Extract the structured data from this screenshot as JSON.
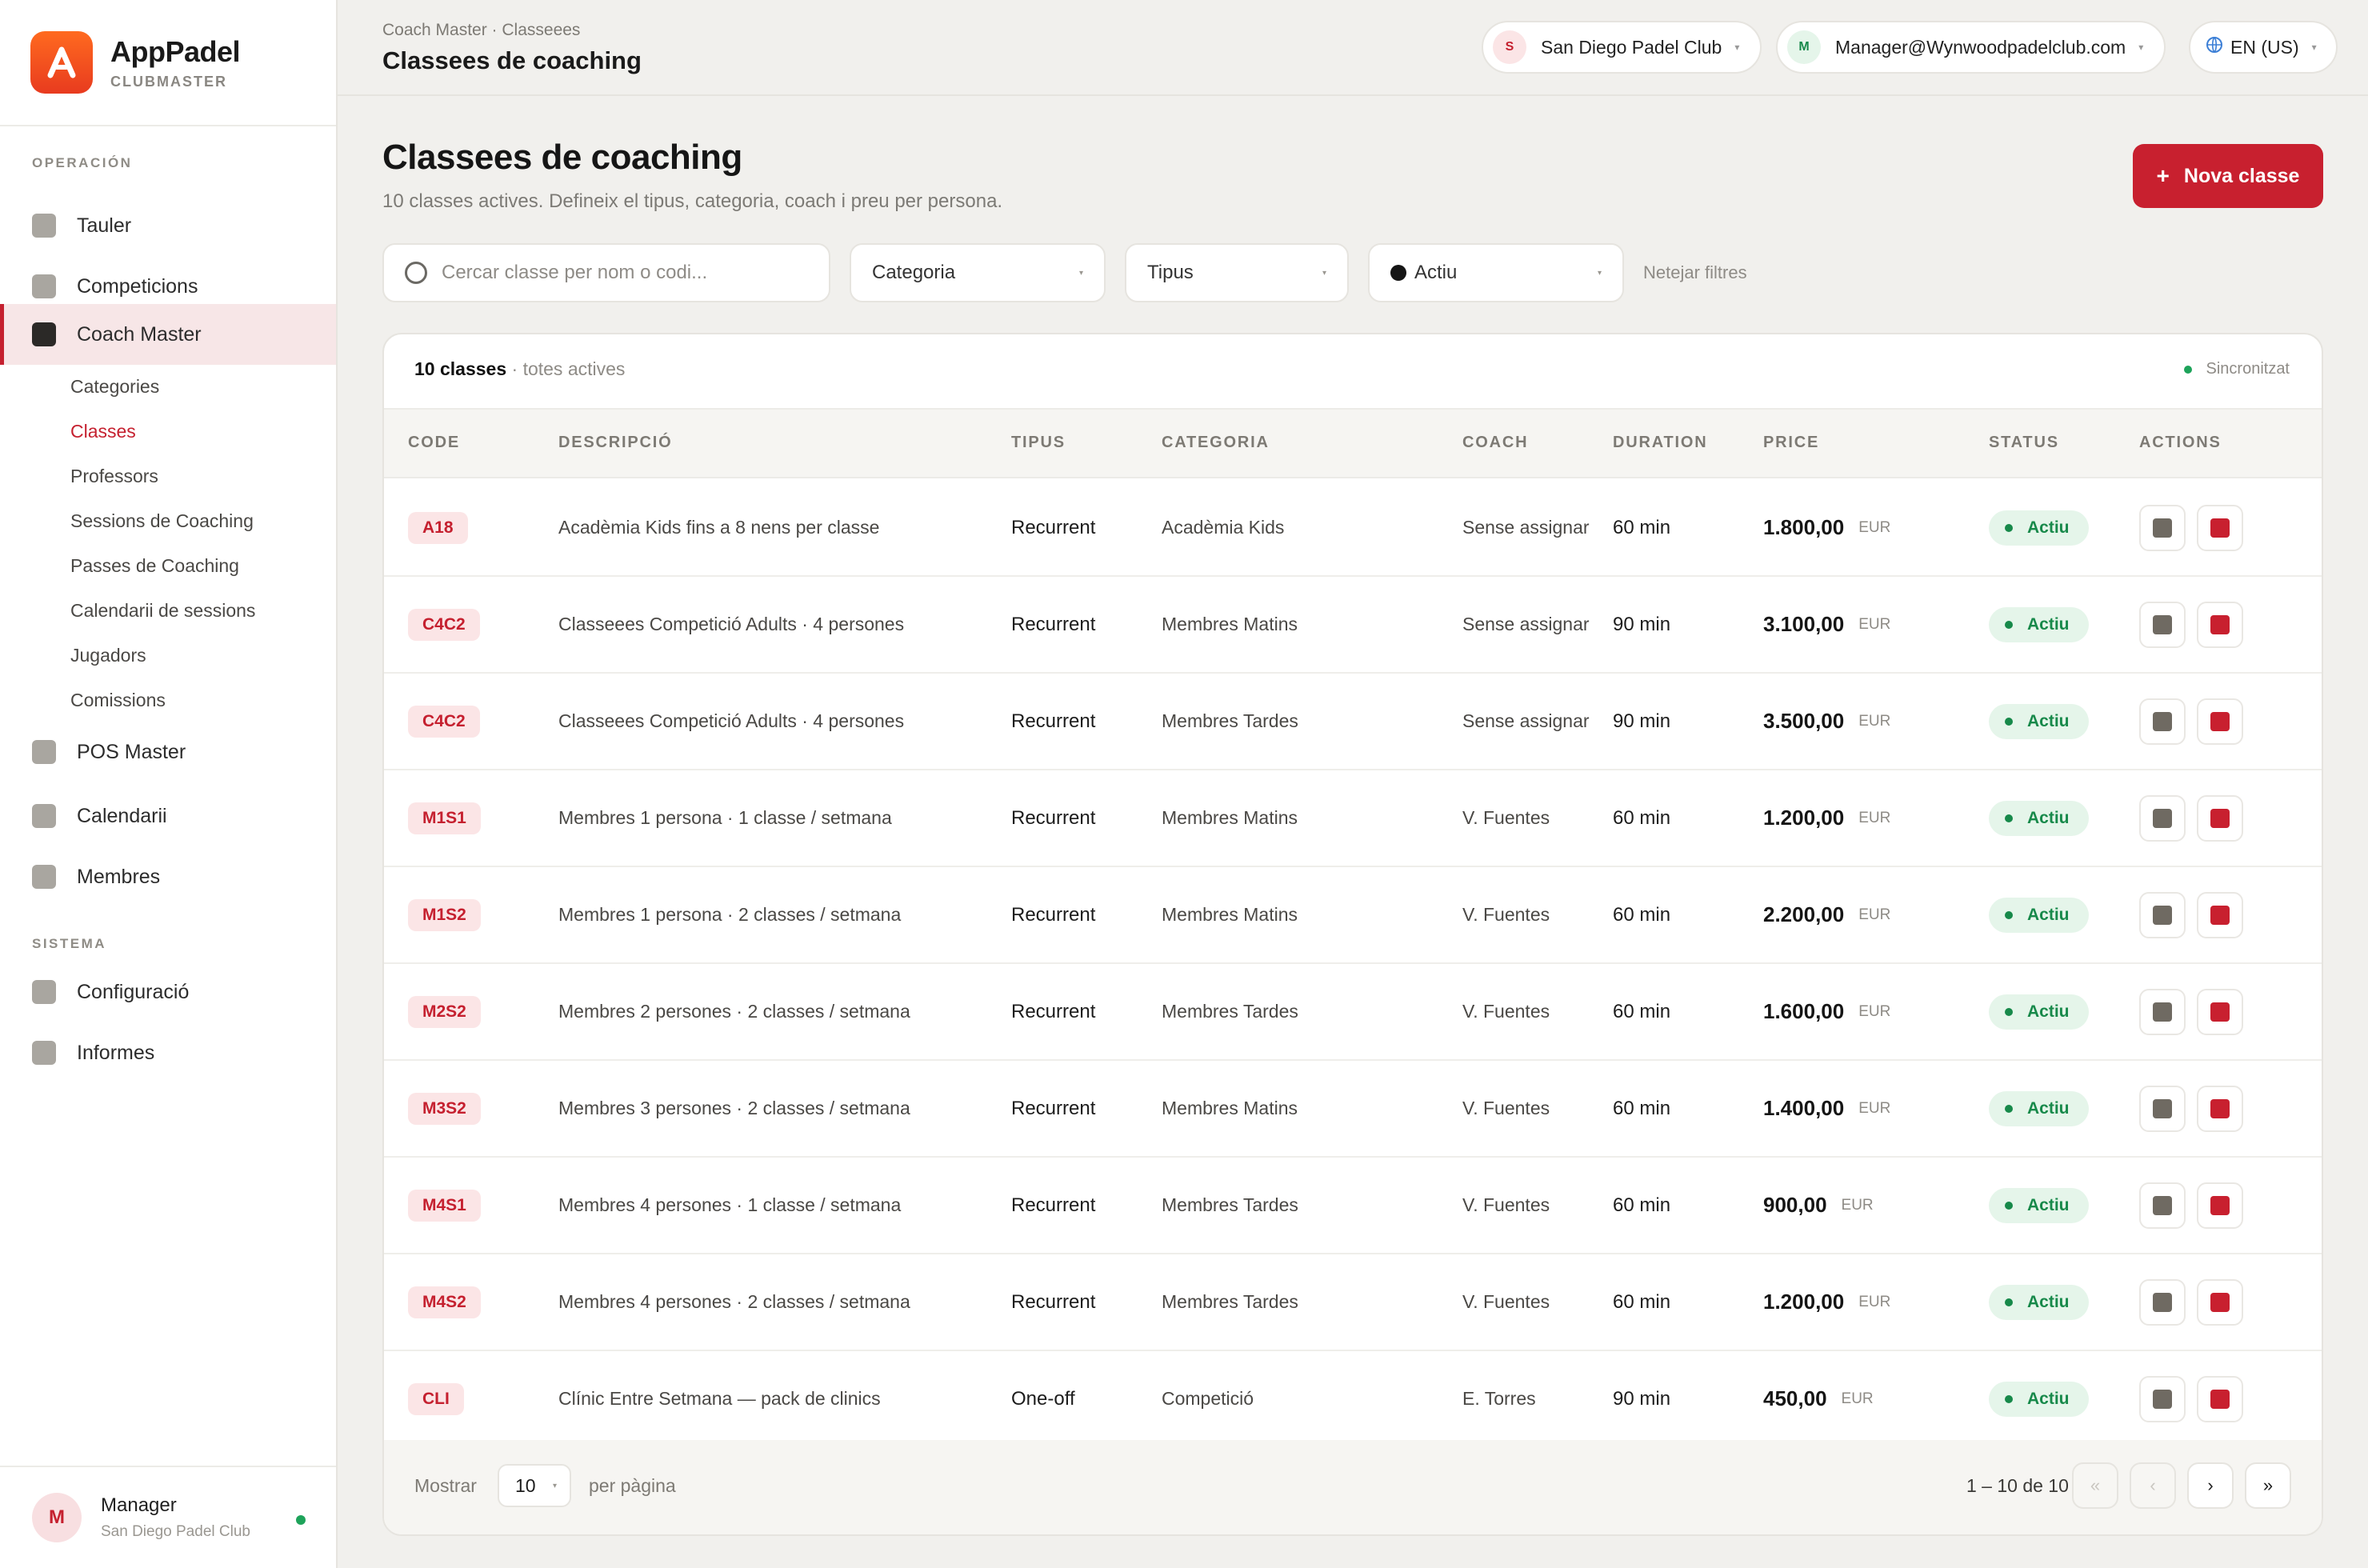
{
  "brand": {
    "name": "AppPadel",
    "subtitle": "CLUBMASTER",
    "accent": "#e83b1f"
  },
  "sidebar": {
    "section_operacio": "OPERACIÓN",
    "section_sistema": "SISTEMA",
    "items": [
      {
        "label": "Tauler"
      },
      {
        "label": "Competicions"
      },
      {
        "label": "Coach Master",
        "active": true
      },
      {
        "label": "POS Master"
      },
      {
        "label": "Calendarii"
      },
      {
        "label": "Membres"
      },
      {
        "label": "Configuració"
      },
      {
        "label": "Informes"
      }
    ],
    "subitems": [
      {
        "label": "Categories"
      },
      {
        "label": "Classes",
        "current": true
      },
      {
        "label": "Professors"
      },
      {
        "label": "Sessions de Coaching"
      },
      {
        "label": "Passes de Coaching"
      },
      {
        "label": "Calendarii de sessions"
      },
      {
        "label": "Jugadors"
      },
      {
        "label": "Comissions"
      }
    ],
    "user": {
      "initial": "M",
      "name": "Manager",
      "club": "San Diego Padel Club"
    }
  },
  "topbar": {
    "breadcrumb": "Coach Master · Classeees",
    "title": "Classees de coaching",
    "club": {
      "initial": "S",
      "label": "San Diego Padel Club"
    },
    "account": {
      "initial": "M",
      "label": "Manager@Wynwoodpadelclub.com"
    },
    "language": "EN (US)"
  },
  "page": {
    "title": "Classees de coaching",
    "subtitle": "10 classes actives. Defineix el tipus, categoria, coach i preu per persona.",
    "new_button": "Nova classe"
  },
  "filters": {
    "search_placeholder": "Cercar classe per nom o codi...",
    "categoria": "Categoria",
    "tipus": "Tipus",
    "estat": "Actiu",
    "clear": "Netejar filtres"
  },
  "table": {
    "count_label": "10 classes",
    "count_note": "· totes actives",
    "sync": "Sincronitzat",
    "columns": [
      "CODE",
      "DESCRIPCIÓ",
      "TIPUS",
      "CATEGORIA",
      "COACH",
      "DURATION",
      "PRICE",
      "STATUS",
      "ACTIONS"
    ],
    "rows": [
      {
        "code": "A18",
        "desc": "Acadèmia Kids fins a 8 nens per classe",
        "tipus": "Recurrent",
        "categoria": "Acadèmia Kids",
        "coach": "Sense assignar",
        "duration": "60 min",
        "price": "1.800,00",
        "currency": "EUR",
        "status": "Actiu"
      },
      {
        "code": "C4C2",
        "desc": "Classeees Competició Adults · 4 persones",
        "tipus": "Recurrent",
        "categoria": "Membres Matins",
        "coach": "Sense assignar",
        "duration": "90 min",
        "price": "3.100,00",
        "currency": "EUR",
        "status": "Actiu"
      },
      {
        "code": "C4C2",
        "desc": "Classeees Competició Adults · 4 persones",
        "tipus": "Recurrent",
        "categoria": "Membres Tardes",
        "coach": "Sense assignar",
        "duration": "90 min",
        "price": "3.500,00",
        "currency": "EUR",
        "status": "Actiu"
      },
      {
        "code": "M1S1",
        "desc": "Membres 1 persona · 1 classe / setmana",
        "tipus": "Recurrent",
        "categoria": "Membres Matins",
        "coach": "V. Fuentes",
        "duration": "60 min",
        "price": "1.200,00",
        "currency": "EUR",
        "status": "Actiu"
      },
      {
        "code": "M1S2",
        "desc": "Membres 1 persona · 2 classes / setmana",
        "tipus": "Recurrent",
        "categoria": "Membres Matins",
        "coach": "V. Fuentes",
        "duration": "60 min",
        "price": "2.200,00",
        "currency": "EUR",
        "status": "Actiu"
      },
      {
        "code": "M2S2",
        "desc": "Membres 2 persones · 2 classes / setmana",
        "tipus": "Recurrent",
        "categoria": "Membres Tardes",
        "coach": "V. Fuentes",
        "duration": "60 min",
        "price": "1.600,00",
        "currency": "EUR",
        "status": "Actiu"
      },
      {
        "code": "M3S2",
        "desc": "Membres 3 persones · 2 classes / setmana",
        "tipus": "Recurrent",
        "categoria": "Membres Matins",
        "coach": "V. Fuentes",
        "duration": "60 min",
        "price": "1.400,00",
        "currency": "EUR",
        "status": "Actiu"
      },
      {
        "code": "M4S1",
        "desc": "Membres 4 persones · 1 classe / setmana",
        "tipus": "Recurrent",
        "categoria": "Membres Tardes",
        "coach": "V. Fuentes",
        "duration": "60 min",
        "price": "900,00",
        "currency": "EUR",
        "status": "Actiu"
      },
      {
        "code": "M4S2",
        "desc": "Membres 4 persones · 2 classes / setmana",
        "tipus": "Recurrent",
        "categoria": "Membres Tardes",
        "coach": "V. Fuentes",
        "duration": "60 min",
        "price": "1.200,00",
        "currency": "EUR",
        "status": "Actiu"
      },
      {
        "code": "CLI",
        "desc": "Clínic Entre Setmana — pack de clinics",
        "tipus": "One-off",
        "categoria": "Competició",
        "coach": "E. Torres",
        "duration": "90 min",
        "price": "450,00",
        "currency": "EUR",
        "status": "Actiu"
      }
    ]
  },
  "pagination": {
    "show_label": "Mostrar",
    "per_page_value": "10",
    "per_page_label": "per pàgina",
    "range": "1 – 10 de 10",
    "first": "«",
    "prev": "‹",
    "next": "›",
    "last": "»"
  },
  "colors": {
    "primary": "#c8202f",
    "success": "#17894a",
    "edit_icon": "#6f6a62",
    "delete_icon": "#c8202f"
  },
  "icons": {
    "edit": "edit-icon",
    "delete": "delete-icon",
    "search": "search-icon",
    "globe": "globe-icon"
  }
}
